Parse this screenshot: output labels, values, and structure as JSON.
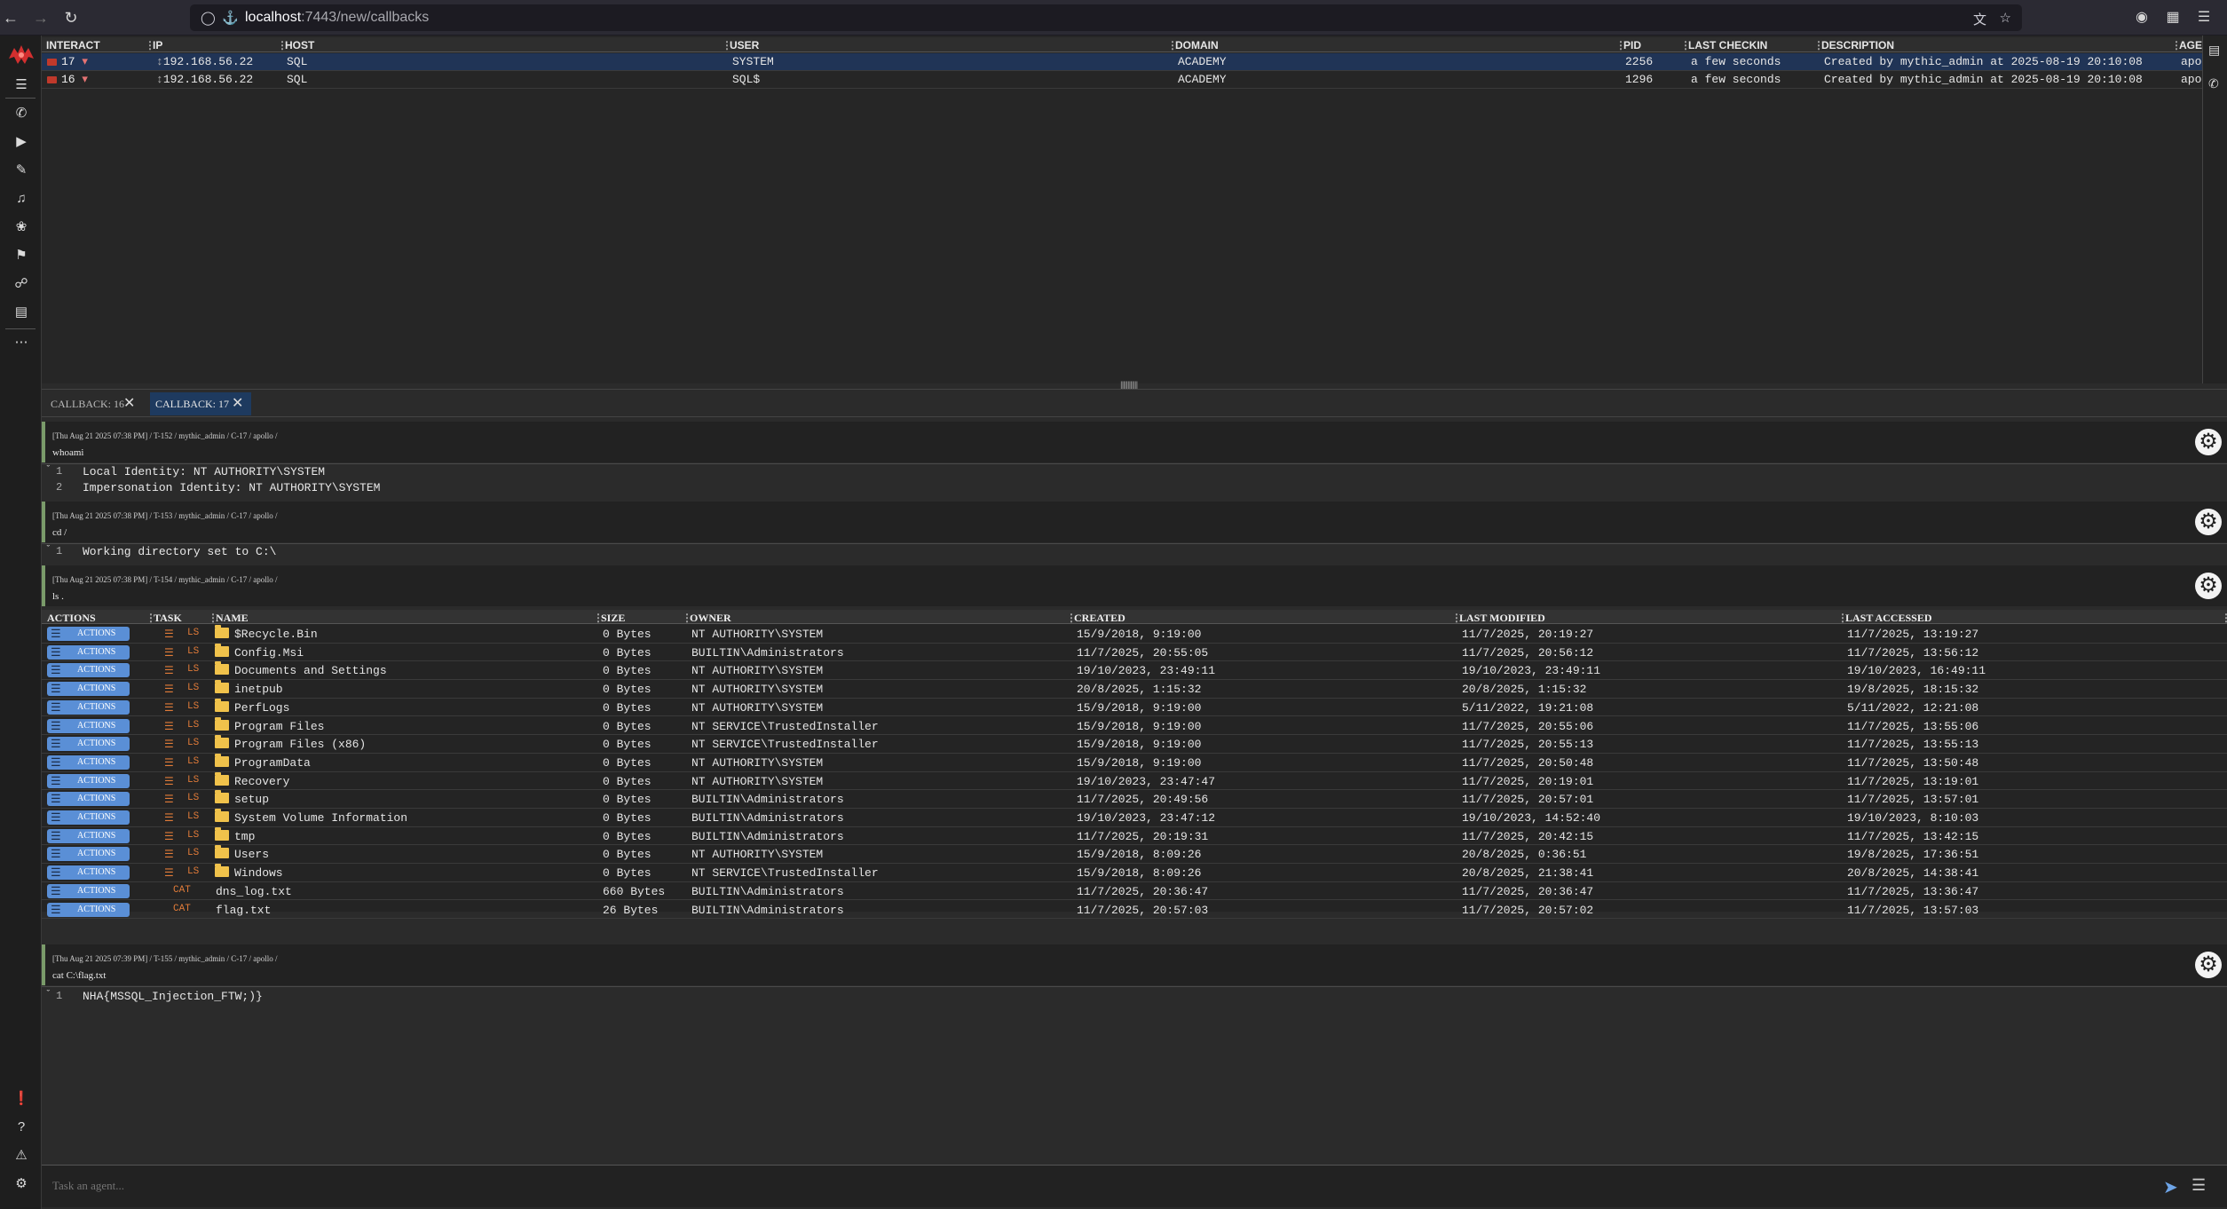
{
  "browser": {
    "url_host": "localhost",
    "url_rest": ":7443/new/callbacks"
  },
  "callbacks": {
    "columns": [
      "INTERACT",
      "IP",
      "HOST",
      "USER",
      "DOMAIN",
      "PID",
      "LAST CHECKIN",
      "DESCRIPTION",
      "AGE"
    ],
    "rows": [
      {
        "id": "17",
        "ip": "192.168.56.22",
        "host": "SQL",
        "user": "SYSTEM",
        "domain": "ACADEMY",
        "pid": "2256",
        "checkin": "a few seconds",
        "description": "Created by mythic_admin at 2025-08-19 20:10:08",
        "agent": "apo"
      },
      {
        "id": "16",
        "ip": "192.168.56.22",
        "host": "SQL",
        "user": "SQL$",
        "domain": "ACADEMY",
        "pid": "1296",
        "checkin": "a few seconds",
        "description": "Created by mythic_admin at 2025-08-19 20:10:08",
        "agent": "apo"
      }
    ]
  },
  "tabs": [
    {
      "label": "CALLBACK: 16"
    },
    {
      "label": "CALLBACK: 17"
    }
  ],
  "tasks": [
    {
      "meta": "[Thu Aug 21 2025 07:38 PM] / T-152 / mythic_admin / C-17 / apollo /",
      "command": "whoami",
      "output": [
        "Local Identity: NT AUTHORITY\\SYSTEM",
        "Impersonation Identity: NT AUTHORITY\\SYSTEM"
      ]
    },
    {
      "meta": "[Thu Aug 21 2025 07:38 PM] / T-153 / mythic_admin / C-17 / apollo /",
      "command": "cd /",
      "output": [
        "Working directory set to C:\\"
      ]
    },
    {
      "meta": "[Thu Aug 21 2025 07:38 PM] / T-154 / mythic_admin / C-17 / apollo /",
      "command": "ls ."
    },
    {
      "meta": "[Thu Aug 21 2025 07:39 PM] / T-155 / mythic_admin / C-17 / apollo /",
      "command": "cat C:\\flag.txt",
      "output": [
        "NHA{MSSQL_Injection_FTW;)}"
      ]
    }
  ],
  "ls": {
    "columns": [
      "ACTIONS",
      "TASK",
      "NAME",
      "SIZE",
      "OWNER",
      "CREATED",
      "LAST MODIFIED",
      "LAST ACCESSED"
    ],
    "action_label": "ACTIONS",
    "rows": [
      {
        "task": "LS",
        "dir": true,
        "name": "$Recycle.Bin",
        "size": "0 Bytes",
        "owner": "NT AUTHORITY\\SYSTEM",
        "created": "15/9/2018, 9:19:00",
        "modified": "11/7/2025, 20:19:27",
        "accessed": "11/7/2025, 13:19:27"
      },
      {
        "task": "LS",
        "dir": true,
        "name": "Config.Msi",
        "size": "0 Bytes",
        "owner": "BUILTIN\\Administrators",
        "created": "11/7/2025, 20:55:05",
        "modified": "11/7/2025, 20:56:12",
        "accessed": "11/7/2025, 13:56:12"
      },
      {
        "task": "LS",
        "dir": true,
        "name": "Documents and Settings",
        "size": "0 Bytes",
        "owner": "NT AUTHORITY\\SYSTEM",
        "created": "19/10/2023, 23:49:11",
        "modified": "19/10/2023, 23:49:11",
        "accessed": "19/10/2023, 16:49:11"
      },
      {
        "task": "LS",
        "dir": true,
        "name": "inetpub",
        "size": "0 Bytes",
        "owner": "NT AUTHORITY\\SYSTEM",
        "created": "20/8/2025, 1:15:32",
        "modified": "20/8/2025, 1:15:32",
        "accessed": "19/8/2025, 18:15:32"
      },
      {
        "task": "LS",
        "dir": true,
        "name": "PerfLogs",
        "size": "0 Bytes",
        "owner": "NT AUTHORITY\\SYSTEM",
        "created": "15/9/2018, 9:19:00",
        "modified": "5/11/2022, 19:21:08",
        "accessed": "5/11/2022, 12:21:08"
      },
      {
        "task": "LS",
        "dir": true,
        "name": "Program Files",
        "size": "0 Bytes",
        "owner": "NT SERVICE\\TrustedInstaller",
        "created": "15/9/2018, 9:19:00",
        "modified": "11/7/2025, 20:55:06",
        "accessed": "11/7/2025, 13:55:06"
      },
      {
        "task": "LS",
        "dir": true,
        "name": "Program Files (x86)",
        "size": "0 Bytes",
        "owner": "NT SERVICE\\TrustedInstaller",
        "created": "15/9/2018, 9:19:00",
        "modified": "11/7/2025, 20:55:13",
        "accessed": "11/7/2025, 13:55:13"
      },
      {
        "task": "LS",
        "dir": true,
        "name": "ProgramData",
        "size": "0 Bytes",
        "owner": "NT AUTHORITY\\SYSTEM",
        "created": "15/9/2018, 9:19:00",
        "modified": "11/7/2025, 20:50:48",
        "accessed": "11/7/2025, 13:50:48"
      },
      {
        "task": "LS",
        "dir": true,
        "name": "Recovery",
        "size": "0 Bytes",
        "owner": "NT AUTHORITY\\SYSTEM",
        "created": "19/10/2023, 23:47:47",
        "modified": "11/7/2025, 20:19:01",
        "accessed": "11/7/2025, 13:19:01"
      },
      {
        "task": "LS",
        "dir": true,
        "name": "setup",
        "size": "0 Bytes",
        "owner": "BUILTIN\\Administrators",
        "created": "11/7/2025, 20:49:56",
        "modified": "11/7/2025, 20:57:01",
        "accessed": "11/7/2025, 13:57:01"
      },
      {
        "task": "LS",
        "dir": true,
        "name": "System Volume Information",
        "size": "0 Bytes",
        "owner": "BUILTIN\\Administrators",
        "created": "19/10/2023, 23:47:12",
        "modified": "19/10/2023, 14:52:40",
        "accessed": "19/10/2023, 8:10:03"
      },
      {
        "task": "LS",
        "dir": true,
        "name": "tmp",
        "size": "0 Bytes",
        "owner": "BUILTIN\\Administrators",
        "created": "11/7/2025, 20:19:31",
        "modified": "11/7/2025, 20:42:15",
        "accessed": "11/7/2025, 13:42:15"
      },
      {
        "task": "LS",
        "dir": true,
        "name": "Users",
        "size": "0 Bytes",
        "owner": "NT AUTHORITY\\SYSTEM",
        "created": "15/9/2018, 8:09:26",
        "modified": "20/8/2025, 0:36:51",
        "accessed": "19/8/2025, 17:36:51"
      },
      {
        "task": "LS",
        "dir": true,
        "name": "Windows",
        "size": "0 Bytes",
        "owner": "NT SERVICE\\TrustedInstaller",
        "created": "15/9/2018, 8:09:26",
        "modified": "20/8/2025, 21:38:41",
        "accessed": "20/8/2025, 14:38:41"
      },
      {
        "task": "CAT",
        "dir": false,
        "name": "dns_log.txt",
        "size": "660 Bytes",
        "owner": "BUILTIN\\Administrators",
        "created": "11/7/2025, 20:36:47",
        "modified": "11/7/2025, 20:36:47",
        "accessed": "11/7/2025, 13:36:47"
      },
      {
        "task": "CAT",
        "dir": false,
        "name": "flag.txt",
        "size": "26 Bytes",
        "owner": "BUILTIN\\Administrators",
        "created": "11/7/2025, 20:57:03",
        "modified": "11/7/2025, 20:57:02",
        "accessed": "11/7/2025, 13:57:03"
      }
    ]
  },
  "input": {
    "placeholder": "Task an agent..."
  }
}
